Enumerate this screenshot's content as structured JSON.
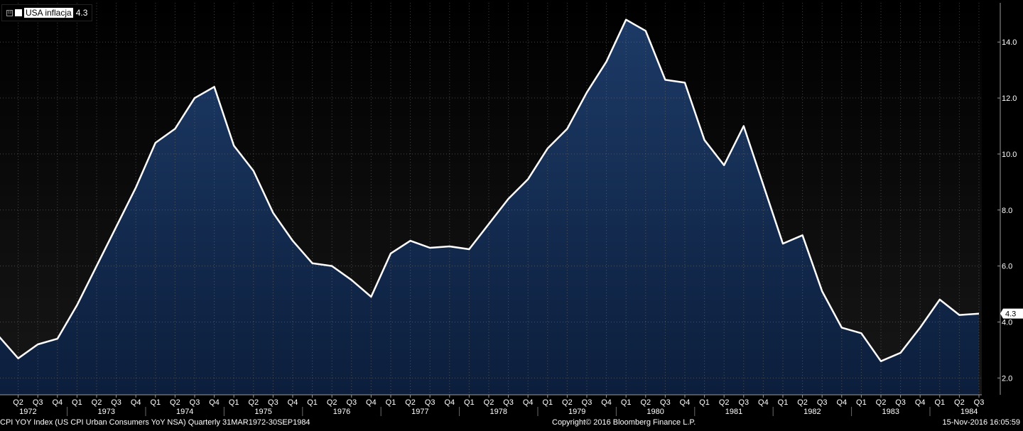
{
  "chart_data": {
    "type": "area",
    "title": "",
    "xlabel": "",
    "ylabel": "",
    "ylim": [
      1.4,
      15.4
    ],
    "y_ticks": [
      "2.0",
      "4.0",
      "6.0",
      "8.0",
      "10.0",
      "12.0",
      "14.0"
    ],
    "grid": true,
    "legend": "top-left",
    "line_color": "#ffffff",
    "fill_color": "#1c3a66",
    "fill_color_bottom": "#0c1e3c",
    "series": [
      {
        "name": "USA inflacja",
        "last_value_label": "4.3",
        "x": [
          "Q1 1972",
          "Q2 1972",
          "Q3 1972",
          "Q4 1972",
          "Q1 1973",
          "Q2 1973",
          "Q3 1973",
          "Q4 1973",
          "Q1 1974",
          "Q2 1974",
          "Q3 1974",
          "Q4 1974",
          "Q1 1975",
          "Q2 1975",
          "Q3 1975",
          "Q4 1975",
          "Q1 1976",
          "Q2 1976",
          "Q3 1976",
          "Q4 1976",
          "Q1 1977",
          "Q2 1977",
          "Q3 1977",
          "Q4 1977",
          "Q1 1978",
          "Q2 1978",
          "Q3 1978",
          "Q4 1978",
          "Q1 1979",
          "Q2 1979",
          "Q3 1979",
          "Q4 1979",
          "Q1 1980",
          "Q2 1980",
          "Q3 1980",
          "Q4 1980",
          "Q1 1981",
          "Q2 1981",
          "Q3 1981",
          "Q4 1981",
          "Q1 1982",
          "Q2 1982",
          "Q3 1982",
          "Q4 1982",
          "Q1 1983",
          "Q2 1983",
          "Q3 1983",
          "Q4 1983",
          "Q1 1984",
          "Q2 1984",
          "Q3 1984"
        ],
        "values": [
          3.5,
          2.7,
          3.2,
          3.4,
          4.6,
          6.0,
          7.4,
          8.8,
          10.4,
          10.9,
          12.0,
          12.4,
          10.3,
          9.4,
          7.9,
          6.9,
          6.1,
          6.0,
          5.5,
          4.9,
          6.45,
          6.9,
          6.65,
          6.7,
          6.6,
          7.5,
          8.4,
          9.1,
          10.2,
          10.9,
          12.2,
          13.3,
          14.8,
          14.4,
          12.65,
          12.55,
          10.5,
          9.6,
          11.0,
          8.9,
          6.8,
          7.1,
          5.1,
          3.8,
          3.6,
          2.6,
          2.9,
          3.8,
          4.8,
          4.25,
          4.3
        ]
      }
    ],
    "x_axis": {
      "quarter_labels": [
        "Q2",
        "Q3",
        "Q4",
        "Q1",
        "Q2",
        "Q3",
        "Q4",
        "Q1",
        "Q2",
        "Q3",
        "Q4",
        "Q1",
        "Q2",
        "Q3",
        "Q4",
        "Q1",
        "Q2",
        "Q3",
        "Q4",
        "Q1",
        "Q2",
        "Q3",
        "Q4",
        "Q1",
        "Q2",
        "Q3",
        "Q4",
        "Q1",
        "Q2",
        "Q3",
        "Q4",
        "Q1",
        "Q2",
        "Q3",
        "Q4",
        "Q1",
        "Q2",
        "Q3",
        "Q4",
        "Q1",
        "Q2",
        "Q3",
        "Q4",
        "Q1",
        "Q2",
        "Q3",
        "Q4",
        "Q1",
        "Q2",
        "Q3"
      ],
      "year_labels": [
        "1972",
        "1973",
        "1974",
        "1975",
        "1976",
        "1977",
        "1978",
        "1979",
        "1980",
        "1981",
        "1982",
        "1983",
        "1984"
      ]
    }
  },
  "legend": {
    "toggle": "⊟",
    "series_name": "USA inflacja",
    "last_value": "4.3"
  },
  "footer": {
    "left": "CPI YOY Index (US CPI Urban Consumers YoY NSA)  Quarterly 31MAR1972-30SEP1984",
    "center": "Copyright© 2016 Bloomberg Finance L.P.",
    "right": "15-Nov-2016 16:05:59"
  }
}
